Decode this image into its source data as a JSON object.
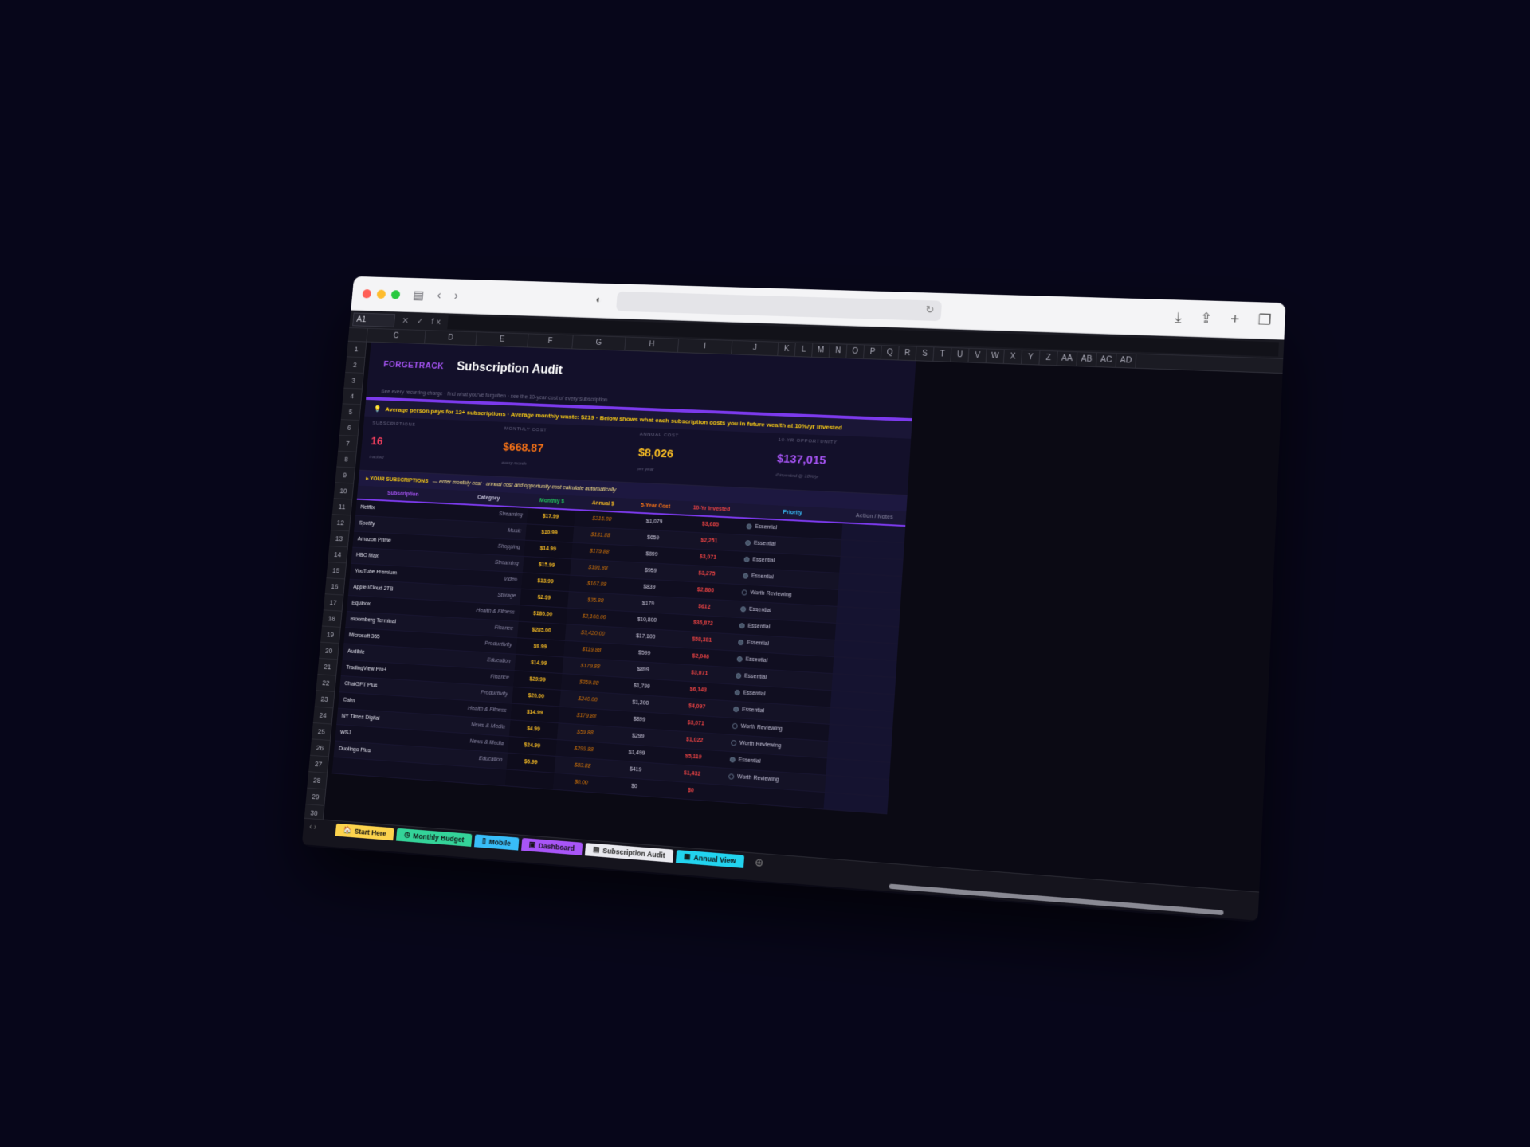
{
  "formula": {
    "cell_ref": "A1",
    "fx": "✕ ✓ fx"
  },
  "columns": [
    "C",
    "D",
    "E",
    "F",
    "G",
    "H",
    "I",
    "J",
    "K",
    "L",
    "M",
    "N",
    "O",
    "P",
    "Q",
    "R",
    "S",
    "T",
    "U",
    "V",
    "W",
    "X",
    "Y",
    "Z",
    "AA",
    "AB",
    "AC",
    "AD"
  ],
  "rows": [
    "1",
    "2",
    "3",
    "4",
    "5",
    "6",
    "7",
    "8",
    "9",
    "10",
    "11",
    "12",
    "13",
    "14",
    "15",
    "16",
    "17",
    "18",
    "19",
    "20",
    "21",
    "22",
    "23",
    "24",
    "25",
    "26",
    "27",
    "28",
    "29",
    "30"
  ],
  "header": {
    "brand": "FORGETRACK",
    "title": "Subscription Audit",
    "subtitle": "See every recurring charge · find what you've forgotten · see the 10-year cost of every subscription"
  },
  "banner": "Average person pays for 12+ subscriptions · Average monthly waste: $219 · Below shows what each subscription costs you in future wealth at 10%/yr invested",
  "kpis": [
    {
      "label": "SUBSCRIPTIONS",
      "value": "16",
      "sub": "tracked",
      "color": "#f43f5e"
    },
    {
      "label": "MONTHLY COST",
      "value": "$668.87",
      "sub": "every month",
      "color": "#f97316"
    },
    {
      "label": "ANNUAL COST",
      "value": "$8,026",
      "sub": "per year",
      "color": "#fbbf24"
    },
    {
      "label": "10-YR OPPORTUNITY",
      "value": "$137,015",
      "sub": "if invested @ 10%/yr",
      "color": "#a855f7"
    }
  ],
  "section": {
    "title": "▸ YOUR SUBSCRIPTIONS",
    "note": "— enter monthly cost · annual cost and opportunity cost calculate automatically"
  },
  "table_headers": [
    "Subscription",
    "Category",
    "Monthly $",
    "Annual $",
    "5-Year Cost",
    "10-Yr Invested",
    "Priority",
    "Action / Notes"
  ],
  "table_header_colors": [
    "#a855f7",
    "#c4c2d8",
    "#22c55e",
    "#fbbf24",
    "#f97316",
    "#ef4444",
    "#38bdf8",
    "#6c6a86"
  ],
  "subscriptions": [
    {
      "name": "Netflix",
      "category": "Streaming",
      "monthly": "$17.99",
      "annual": "$215.88",
      "five": "$1,079",
      "ten": "$3,685",
      "priority": "Essential"
    },
    {
      "name": "Spotify",
      "category": "Music",
      "monthly": "$10.99",
      "annual": "$131.88",
      "five": "$659",
      "ten": "$2,251",
      "priority": "Essential"
    },
    {
      "name": "Amazon Prime",
      "category": "Shopping",
      "monthly": "$14.99",
      "annual": "$179.88",
      "five": "$899",
      "ten": "$3,071",
      "priority": "Essential"
    },
    {
      "name": "HBO Max",
      "category": "Streaming",
      "monthly": "$15.99",
      "annual": "$191.88",
      "five": "$959",
      "ten": "$3,275",
      "priority": "Essential"
    },
    {
      "name": "YouTube Premium",
      "category": "Video",
      "monthly": "$13.99",
      "annual": "$167.88",
      "five": "$839",
      "ten": "$2,866",
      "priority": "Worth Reviewing"
    },
    {
      "name": "Apple iCloud 2TB",
      "category": "Storage",
      "monthly": "$2.99",
      "annual": "$35.88",
      "five": "$179",
      "ten": "$612",
      "priority": "Essential"
    },
    {
      "name": "Equinox",
      "category": "Health & Fitness",
      "monthly": "$180.00",
      "annual": "$2,160.00",
      "five": "$10,800",
      "ten": "$36,872",
      "priority": "Essential"
    },
    {
      "name": "Bloomberg Terminal",
      "category": "Finance",
      "monthly": "$285.00",
      "annual": "$3,420.00",
      "five": "$17,100",
      "ten": "$58,381",
      "priority": "Essential"
    },
    {
      "name": "Microsoft 365",
      "category": "Productivity",
      "monthly": "$9.99",
      "annual": "$119.88",
      "five": "$599",
      "ten": "$2,046",
      "priority": "Essential"
    },
    {
      "name": "Audible",
      "category": "Education",
      "monthly": "$14.99",
      "annual": "$179.88",
      "five": "$899",
      "ten": "$3,071",
      "priority": "Essential"
    },
    {
      "name": "TradingView Pro+",
      "category": "Finance",
      "monthly": "$29.99",
      "annual": "$359.88",
      "five": "$1,799",
      "ten": "$6,143",
      "priority": "Essential"
    },
    {
      "name": "ChatGPT Plus",
      "category": "Productivity",
      "monthly": "$20.00",
      "annual": "$240.00",
      "five": "$1,200",
      "ten": "$4,097",
      "priority": "Essential"
    },
    {
      "name": "Calm",
      "category": "Health & Fitness",
      "monthly": "$14.99",
      "annual": "$179.88",
      "five": "$899",
      "ten": "$3,071",
      "priority": "Worth Reviewing"
    },
    {
      "name": "NY Times Digital",
      "category": "News & Media",
      "monthly": "$4.99",
      "annual": "$59.88",
      "five": "$299",
      "ten": "$1,022",
      "priority": "Worth Reviewing"
    },
    {
      "name": "WSJ",
      "category": "News & Media",
      "monthly": "$24.99",
      "annual": "$299.88",
      "five": "$1,499",
      "ten": "$5,119",
      "priority": "Essential"
    },
    {
      "name": "Duolingo Plus",
      "category": "Education",
      "monthly": "$6.99",
      "annual": "$83.88",
      "five": "$419",
      "ten": "$1,432",
      "priority": "Worth Reviewing"
    },
    {
      "name": "",
      "category": "",
      "monthly": "",
      "annual": "$0.00",
      "five": "$0",
      "ten": "$0",
      "priority": ""
    }
  ],
  "tabs": [
    {
      "label": "Start Here",
      "icon": "🏠",
      "color": "#fcd34d"
    },
    {
      "label": "Monthly Budget",
      "icon": "◷",
      "color": "#34d399"
    },
    {
      "label": "Mobile",
      "icon": "▯",
      "color": "#38bdf8"
    },
    {
      "label": "Dashboard",
      "icon": "▣",
      "color": "#a855f7"
    },
    {
      "label": "Subscription Audit",
      "icon": "▤",
      "color": "#e9e9ef"
    },
    {
      "label": "Annual View",
      "icon": "▦",
      "color": "#22d3ee"
    }
  ],
  "active_tab": "Subscription Audit"
}
